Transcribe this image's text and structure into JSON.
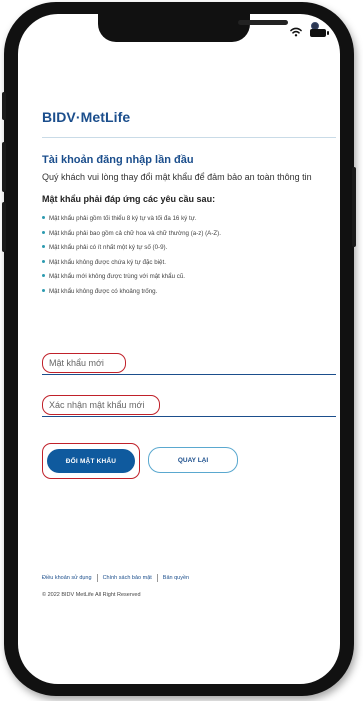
{
  "brand": {
    "logo_text": "BIDV·MetLife",
    "color": "#1b4e8c",
    "accent": "#c0212a"
  },
  "page": {
    "title": "Tài khoản đăng nhập lần đầu",
    "subtitle": "Quý khách vui lòng thay đổi mật khẩu để đảm bảo an toàn thông tin",
    "requirements_title": "Mật khẩu phải đáp ứng các yêu cầu sau:",
    "requirements": [
      "Mật khẩu phải gồm tối thiểu 8 ký tự và tối đa 16 ký tự.",
      "Mật khẩu phải bao gồm cả chữ hoa và chữ thường (a-z) (A-Z).",
      "Mật khẩu phải có ít nhất một ký tự số (0-9).",
      "Mật khẩu không được chứa ký tự đặc biệt.",
      "Mật khẩu mới không được trùng với mật khẩu cũ.",
      "Mật khẩu không được có khoảng trống."
    ]
  },
  "form": {
    "new_password_placeholder": "Mật khẩu mới",
    "confirm_password_placeholder": "Xác nhận mật khẩu mới",
    "submit_label": "ĐỔI MẬT KHẨU",
    "back_label": "QUAY LẠI"
  },
  "footer": {
    "links": [
      "Điều khoản sử dụng",
      "Chính sách bảo mật",
      "Bản quyền"
    ],
    "copyright": "© 2022 BIDV MetLife All Right Reserved"
  },
  "status_bar": {
    "icons": [
      "wifi-icon",
      "battery-icon"
    ]
  }
}
